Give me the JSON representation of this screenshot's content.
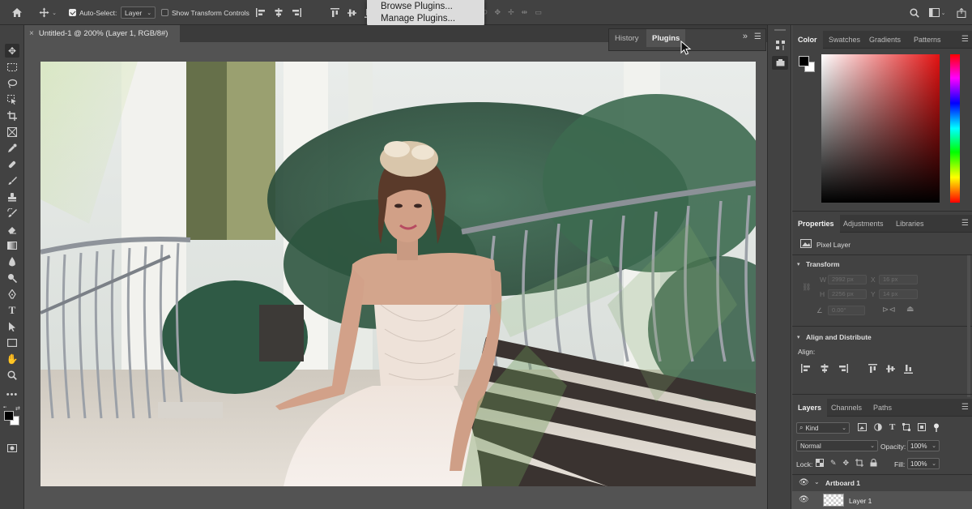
{
  "options_bar": {
    "auto_select_label": "Auto-Select:",
    "auto_select_checked": true,
    "auto_select_value": "Layer",
    "show_transform_label": "Show Transform Controls",
    "show_transform_checked": false
  },
  "plugins_menu": {
    "items": [
      "Browse Plugins...",
      "Manage Plugins..."
    ]
  },
  "document": {
    "tab_title": "Untitled-1 @ 200% (Layer 1, RGB/8#)",
    "close_glyph": "×"
  },
  "mid_panel": {
    "tabs": [
      "History",
      "Plugins"
    ],
    "active_tab": "Plugins",
    "collapse_glyph": "»"
  },
  "color_panel": {
    "tabs": [
      "Color",
      "Swatches",
      "Gradients",
      "Patterns"
    ],
    "active_tab": "Color",
    "hue_color": "#e31212"
  },
  "properties_panel": {
    "tabs": [
      "Properties",
      "Adjustments",
      "Libraries"
    ],
    "active_tab": "Properties",
    "layer_kind": "Pixel Layer",
    "transform_title": "Transform",
    "w_label": "W",
    "w_value": "2992 px",
    "h_label": "H",
    "h_value": "2256 px",
    "x_label": "X",
    "x_value": "16 px",
    "y_label": "Y",
    "y_value": "14 px",
    "angle_value": "0.00°",
    "align_title": "Align and Distribute",
    "align_label": "Align:"
  },
  "layers_panel": {
    "tabs": [
      "Layers",
      "Channels",
      "Paths"
    ],
    "active_tab": "Layers",
    "filter_kind": "Kind",
    "blend_mode": "Normal",
    "opacity_label": "Opacity:",
    "opacity_value": "100%",
    "lock_label": "Lock:",
    "fill_label": "Fill:",
    "fill_value": "100%",
    "layers": [
      {
        "name": "Artboard 1",
        "type": "artboard"
      },
      {
        "name": "Layer 1",
        "type": "pixel"
      }
    ]
  }
}
